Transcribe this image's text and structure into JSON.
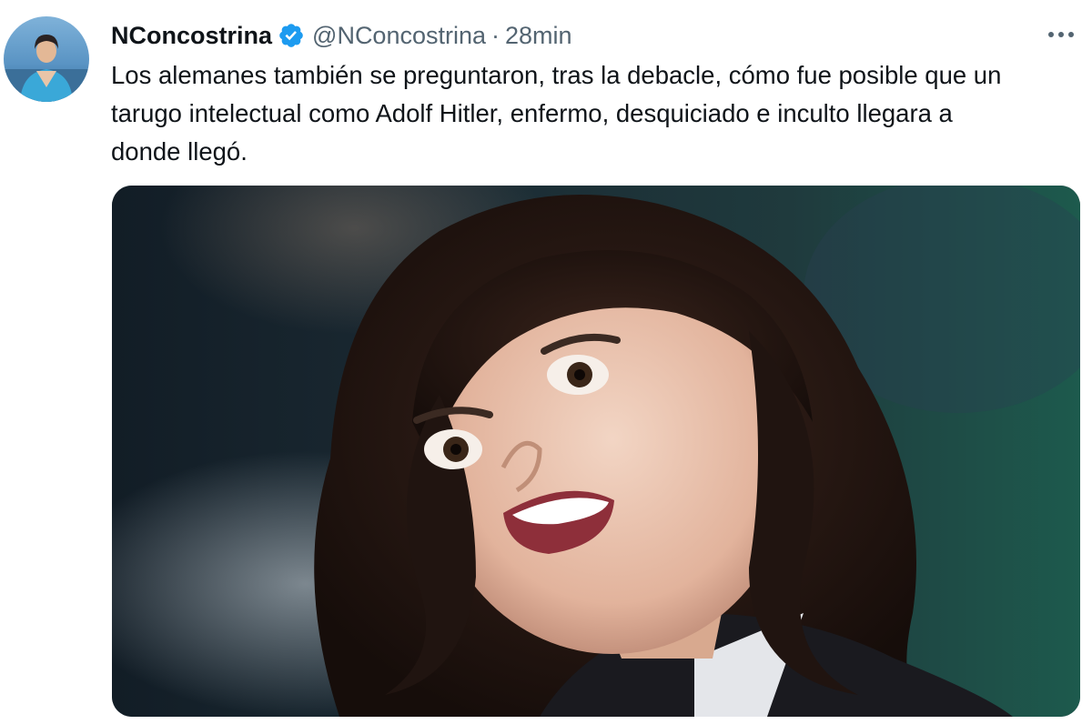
{
  "tweet": {
    "display_name": "NConcostrina",
    "handle": "@NConcostrina",
    "separator": "·",
    "timestamp": "28min",
    "text_lines": [
      "Los alemanes también se preguntaron, tras la debacle, cómo fue posible que un",
      "tarugo intelectual como Adolf Hitler, enfermo, desquiciado e inculto llegara a",
      "donde llegó."
    ],
    "avatar_icon": "profile-photo",
    "verified_icon": "verified-badge-icon",
    "more_icon": "more-options-icon",
    "media_icon": "attached-photo"
  },
  "colors": {
    "text_primary": "#0f1419",
    "text_secondary": "#536471",
    "verified_blue": "#1d9bf0"
  }
}
